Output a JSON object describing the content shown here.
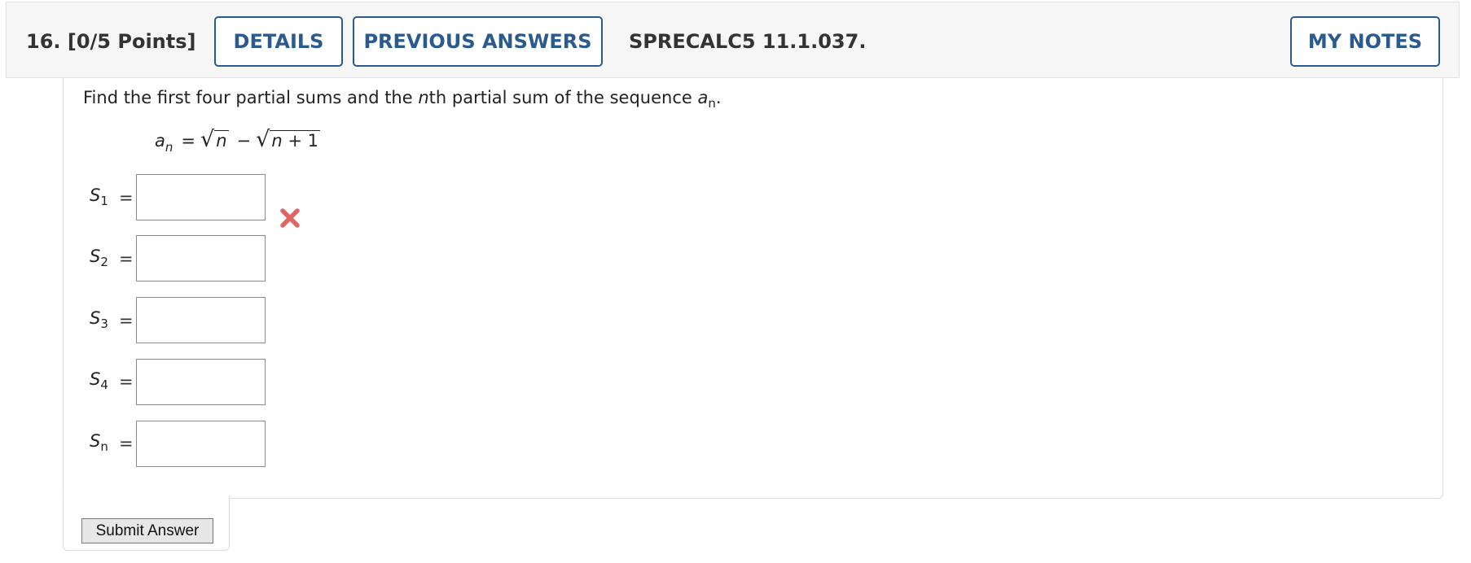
{
  "header": {
    "question_label": "16.  [0/5 Points]",
    "details_label": "DETAILS",
    "previous_answers_label": "PREVIOUS ANSWERS",
    "problem_code": "SPRECALC5 11.1.037.",
    "my_notes_label": "MY NOTES"
  },
  "question": {
    "prompt_before": "Find the first four partial sums and the ",
    "prompt_n": "n",
    "prompt_middle": "th partial sum of the sequence ",
    "prompt_a": "a",
    "prompt_sub": "n",
    "prompt_end": ".",
    "formula": {
      "lhs_var": "a",
      "lhs_sub": "n",
      "equals": "=",
      "sqrt1_radicand": "n",
      "minus": "−",
      "sqrt2_var": "n",
      "sqrt2_rest": " + 1"
    }
  },
  "answers": [
    {
      "var": "S",
      "sub": "1",
      "equals": "=",
      "value": "",
      "status": "incorrect"
    },
    {
      "var": "S",
      "sub": "2",
      "equals": "=",
      "value": "",
      "status": ""
    },
    {
      "var": "S",
      "sub": "3",
      "equals": "=",
      "value": "",
      "status": ""
    },
    {
      "var": "S",
      "sub": "4",
      "equals": "=",
      "value": "",
      "status": ""
    },
    {
      "var": "S",
      "sub": "n",
      "equals": "=",
      "value": "",
      "status": ""
    }
  ],
  "submit_label": "Submit Answer",
  "colors": {
    "accent": "#2b5a8e",
    "incorrect": "#e06666",
    "header_bg": "#f6f6f6"
  },
  "icons": {
    "incorrect": "x-mark-icon"
  }
}
